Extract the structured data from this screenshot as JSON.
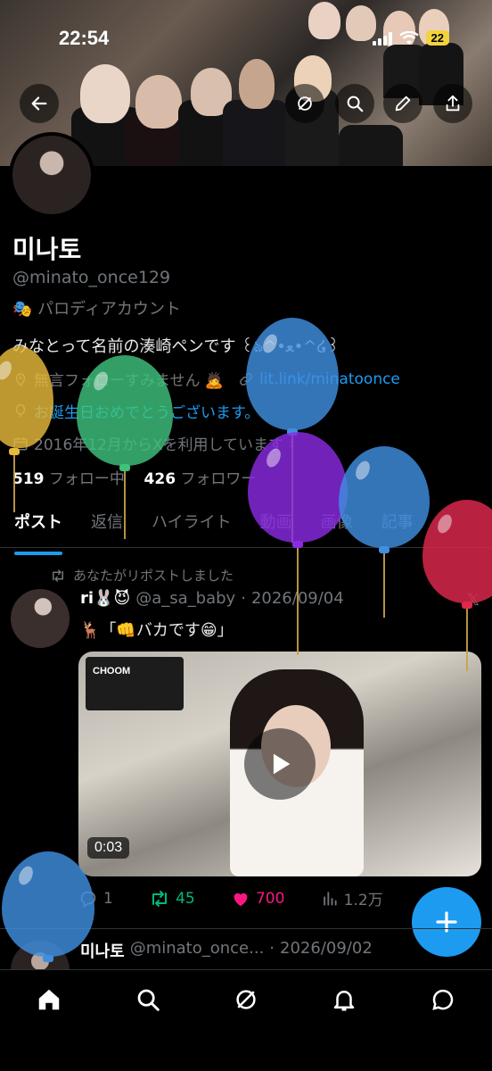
{
  "status_bar": {
    "time": "22:54",
    "battery": "22"
  },
  "header_buttons": {
    "back": "back-arrow-icon",
    "grok": "grok-icon",
    "search": "search-icon",
    "edit": "pencil-icon",
    "share": "share-icon"
  },
  "profile": {
    "name": "미나토",
    "handle": "@minato_once129",
    "parody_label": "パロディアカウント",
    "bio": "みなとって名前の湊崎ペンです ꒰ঌ^•ﻌ•^໒꒱",
    "rule": "無言フォローすみません 🙇",
    "link": "lit.link/minatoonce",
    "birthday": "お誕生日おめでとうございます。",
    "joined": "2016年12月からXを利用しています",
    "following_count": "519",
    "following_label": "フォロー中",
    "followers_count": "426",
    "followers_label": "フォロワー"
  },
  "tabs": [
    {
      "label": "ポスト"
    },
    {
      "label": "返信"
    },
    {
      "label": "ハイライト"
    },
    {
      "label": "動画"
    },
    {
      "label": "画像"
    },
    {
      "label": "記事"
    }
  ],
  "post1": {
    "repost_note": "あなたがリポストしました",
    "author": "ri🐰😈",
    "handle": "@a_sa_baby",
    "dot": "·",
    "date": "2026/09/04",
    "text": "🦌「👊バカです😁」",
    "video_poster": "CHOOM",
    "video_duration": "0:03",
    "replies": "1",
    "reposts": "45",
    "likes": "700",
    "views": "1.2万"
  },
  "post2": {
    "author": "미나토",
    "handle": "@minato_once...",
    "dot": "·",
    "date": "2026/09/02"
  },
  "colors": {
    "accent": "#1d9bf0",
    "repost": "#00ba7c",
    "like": "#f91880",
    "muted": "#71767b"
  },
  "bottom_nav": [
    "home-icon",
    "search-icon",
    "grok-icon",
    "notifications-icon",
    "messages-icon"
  ],
  "balloons": [
    "yellow",
    "green",
    "blue",
    "purple",
    "blue",
    "red",
    "blue"
  ]
}
